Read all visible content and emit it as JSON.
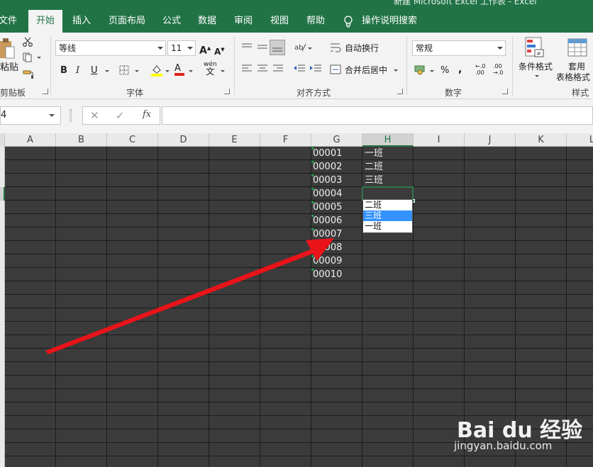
{
  "window": {
    "title": "新建 Microsoft Excel 工作表 - Excel"
  },
  "tabs": [
    {
      "label": "文件"
    },
    {
      "label": "开始",
      "active": true
    },
    {
      "label": "插入"
    },
    {
      "label": "页面布局"
    },
    {
      "label": "公式"
    },
    {
      "label": "数据"
    },
    {
      "label": "审阅"
    },
    {
      "label": "视图"
    },
    {
      "label": "帮助"
    },
    {
      "label": "操作说明搜索"
    }
  ],
  "ribbon": {
    "clipboard": {
      "paste_label": "粘贴",
      "group_label": "剪贴板"
    },
    "font": {
      "font_name": "等线",
      "font_size": "11",
      "phonetic": "wén",
      "group_label": "字体"
    },
    "alignment": {
      "wrap_text": "自动换行",
      "merge_center": "合并后居中",
      "group_label": "对齐方式"
    },
    "number": {
      "format": "常规",
      "group_label": "数字"
    },
    "styles": {
      "conditional_format": "条件格式",
      "table_format_1": "套用",
      "table_format_2": "表格格式",
      "group_label": "样式"
    }
  },
  "formula_bar": {
    "name_box": "4",
    "fx_label": "fx",
    "value": ""
  },
  "grid": {
    "columns": [
      "A",
      "B",
      "C",
      "D",
      "E",
      "F",
      "G",
      "H",
      "I",
      "J",
      "K",
      "L"
    ],
    "selected_column": "H",
    "col_g_values": [
      "00001",
      "00002",
      "00003",
      "00004",
      "00005",
      "00006",
      "00007",
      "00008",
      "00009",
      "00010"
    ],
    "col_h_values": [
      "一班",
      "二班",
      "三班"
    ]
  },
  "dropdown": {
    "options": [
      "二班",
      "三班",
      "一班"
    ],
    "highlighted": "三班"
  },
  "annotation": {
    "arrow_color": "#e8141a"
  },
  "watermark": {
    "logo_text": "Bai du 经验",
    "url": "jingyan.baidu.com"
  },
  "colors": {
    "excel_green": "#217346",
    "highlight_blue": "#3392ff",
    "sheet_bg": "#3b3b3b"
  }
}
